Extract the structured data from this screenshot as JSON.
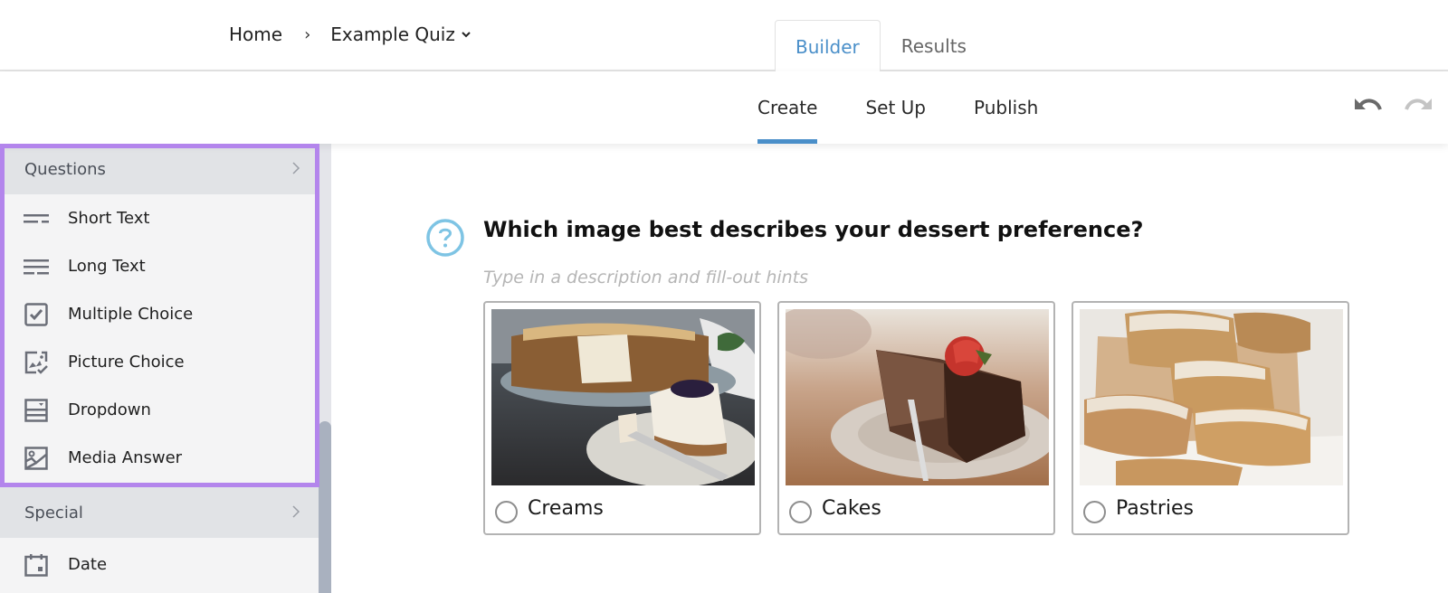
{
  "breadcrumb": {
    "home": "Home",
    "separator": "›",
    "current": "Example Quiz"
  },
  "top_tabs": [
    {
      "label": "Builder",
      "active": true
    },
    {
      "label": "Results",
      "active": false
    }
  ],
  "sub_tabs": [
    {
      "label": "Create",
      "active": true
    },
    {
      "label": "Set Up",
      "active": false
    },
    {
      "label": "Publish",
      "active": false
    }
  ],
  "toolbar": {
    "undo_icon": "undo-icon",
    "redo_icon": "redo-icon"
  },
  "sidebar": {
    "groups": [
      {
        "label": "Questions",
        "items": [
          {
            "label": "Short Text",
            "icon": "short-text-icon"
          },
          {
            "label": "Long Text",
            "icon": "long-text-icon"
          },
          {
            "label": "Multiple Choice",
            "icon": "checkbox-icon"
          },
          {
            "label": "Picture Choice",
            "icon": "picture-choice-icon"
          },
          {
            "label": "Dropdown",
            "icon": "dropdown-icon"
          },
          {
            "label": "Media Answer",
            "icon": "media-answer-icon"
          }
        ]
      },
      {
        "label": "Special",
        "items": [
          {
            "label": "Date",
            "icon": "calendar-icon"
          }
        ]
      }
    ]
  },
  "question": {
    "icon": "question-circle-icon",
    "title": "Which image best describes your dessert preference?",
    "hint_placeholder": "Type in a description and fill-out hints",
    "choices": [
      {
        "label": "Creams",
        "image": "cheesecake-photo"
      },
      {
        "label": "Cakes",
        "image": "chocolate-cake-photo"
      },
      {
        "label": "Pastries",
        "image": "pastries-photo"
      }
    ]
  },
  "colors": {
    "accent": "#4a8fc9",
    "highlight": "#b385ec",
    "question_icon": "#7ec4e4"
  }
}
